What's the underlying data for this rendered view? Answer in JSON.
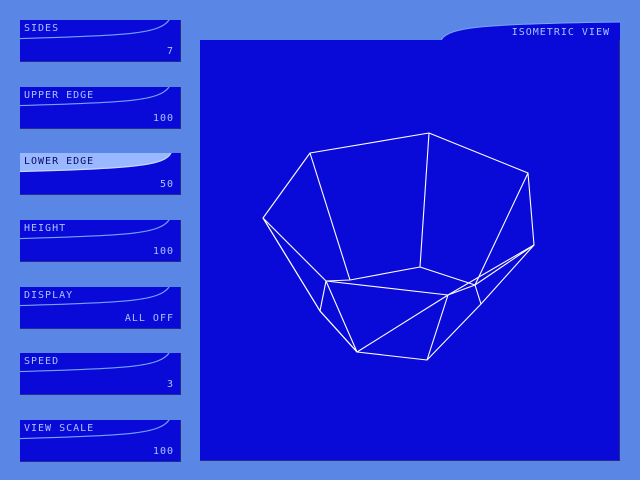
{
  "view": {
    "title": "ISOMETRIC VIEW"
  },
  "panels": [
    {
      "label": "SIDES",
      "value": "7"
    },
    {
      "label": "UPPER EDGE",
      "value": "100"
    },
    {
      "label": "LOWER EDGE",
      "value": "50"
    },
    {
      "label": "HEIGHT",
      "value": "100"
    },
    {
      "label": "DISPLAY",
      "value": "ALL OFF"
    },
    {
      "label": "SPEED",
      "value": "3"
    },
    {
      "label": "VIEW SCALE",
      "value": "100"
    }
  ],
  "colors": {
    "background": "#5a86e6",
    "panel": "#0a0ad8",
    "text": "#a8c4ff",
    "highlight": "#9ab8ff",
    "wireframe": "#ffffff"
  }
}
